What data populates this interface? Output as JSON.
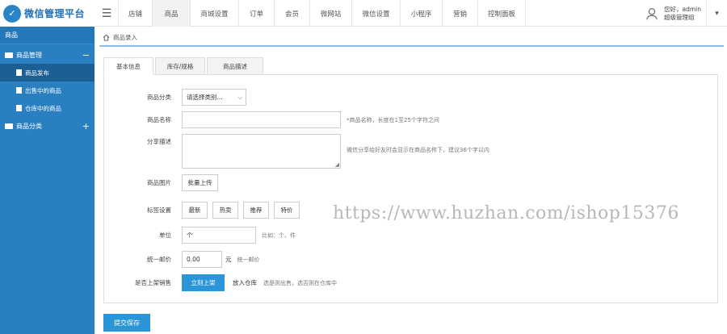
{
  "header": {
    "logo_text": "微信管理平台",
    "nav": [
      "店铺",
      "商品",
      "商城设置",
      "订单",
      "会员",
      "微网站",
      "微信设置",
      "小程序",
      "营销",
      "控制面板"
    ],
    "active_nav": 1,
    "user_greeting": "您好，admin",
    "user_role": "超级管理组"
  },
  "sidebar": {
    "title": "商品",
    "group1": "商品管理",
    "group1_toggle": "−",
    "items": [
      "商品发布",
      "出售中的商品",
      "仓库中的商品"
    ],
    "active_item": 0,
    "group2": "商品分类",
    "group2_toggle": "+"
  },
  "breadcrumb": {
    "label": "商品录入"
  },
  "tabs": [
    "基本信息",
    "库存/规格",
    "商品描述"
  ],
  "form": {
    "category_label": "商品分类",
    "category_value": "请选择类别...",
    "name_label": "商品名称",
    "name_hint": "*商品名称，长度在1至25个字符之间",
    "share_label": "分享描述",
    "share_hint": "微信分享给好友时会显示在商品名称下，建议36个字以内",
    "image_label": "商品图片",
    "image_button": "批量上传",
    "tag_label": "标签设置",
    "tags": [
      "最新",
      "热卖",
      "推荐",
      "特价"
    ],
    "unit_label": "单位",
    "unit_value": "个",
    "unit_hint": "比如：个、件",
    "price_label": "统一邮价",
    "price_value": "0.00",
    "price_unit": "元",
    "price_hint": "统一邮价",
    "shelf_label": "是否上架销售",
    "shelf_now": "立刻上架",
    "shelf_store": "放入仓库",
    "shelf_hint": "选是则出售，选否则在仓库中"
  },
  "save_button": "提交保存",
  "watermark": "https://www.huzhan.com/ishop15376",
  "colors": {
    "primary": "#2a96d8",
    "sidebar": "#2a7fc0",
    "sidebar_active": "#1c5f95"
  }
}
